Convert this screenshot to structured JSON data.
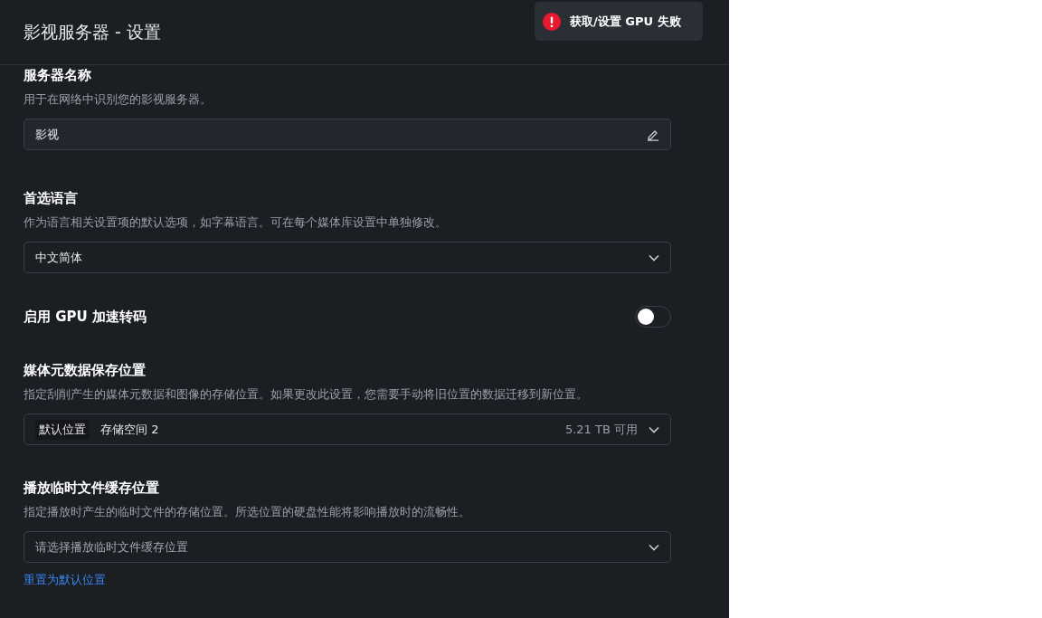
{
  "window": {
    "title": "影视服务器 - 设置"
  },
  "toast": {
    "text": "获取/设置 GPU 失败"
  },
  "sections": [
    {
      "kind": "text",
      "title": "服务器名称",
      "description": "用于在网络中识别您的影视服务器。",
      "value": "影视"
    },
    {
      "kind": "select",
      "title": "首选语言",
      "description": "作为语言相关设置项的默认选项，如字幕语言。可在每个媒体库设置中单独修改。",
      "value": "中文简体"
    },
    {
      "kind": "toggle",
      "title": "启用 GPU 加速转码",
      "on": false
    },
    {
      "kind": "storage",
      "title": "媒体元数据保存位置",
      "description": "指定刮削产生的媒体元数据和图像的存储位置。如果更改此设置，您需要手动将旧位置的数据迁移到新位置。",
      "tag": "默认位置",
      "value": "存储空间 2",
      "free": "5.21 TB 可用"
    },
    {
      "kind": "select",
      "title": "播放临时文件缓存位置",
      "description": "指定播放时产生的临时文件的存储位置。所选位置的硬盘性能将影响播放时的流畅性。",
      "placeholder": "请选择播放临时文件缓存位置",
      "link": "重置为默认位置"
    }
  ]
}
